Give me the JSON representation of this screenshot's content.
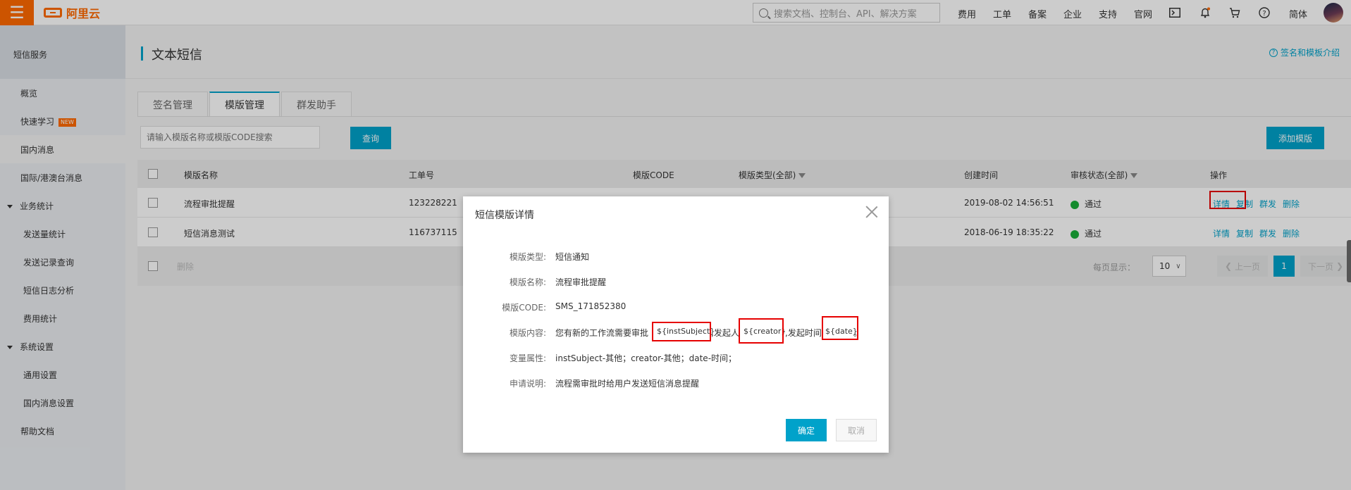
{
  "topbar": {
    "brand": "阿里云",
    "search_placeholder": "搜索文档、控制台、API、解决方案",
    "nav": [
      "费用",
      "工单",
      "备案",
      "企业",
      "支持",
      "官网"
    ],
    "lang": "简体"
  },
  "sidebar": {
    "title": "短信服务",
    "items": [
      {
        "label": "概览"
      },
      {
        "label": "快速学习",
        "tag": "NEW"
      },
      {
        "label": "国内消息"
      },
      {
        "label": "国际/港澳台消息"
      },
      {
        "label": "业务统计"
      },
      {
        "label": "发送量统计"
      },
      {
        "label": "发送记录查询"
      },
      {
        "label": "短信日志分析"
      },
      {
        "label": "费用统计"
      },
      {
        "label": "系统设置"
      },
      {
        "label": "通用设置"
      },
      {
        "label": "国内消息设置"
      },
      {
        "label": "帮助文档"
      }
    ]
  },
  "page": {
    "title": "文本短信",
    "help_link": "签名和模板介绍",
    "tabs": [
      "签名管理",
      "模版管理",
      "群发助手"
    ],
    "search_placeholder": "请输入模版名称或模版CODE搜索",
    "query_button": "查询",
    "add_button": "添加模版"
  },
  "table": {
    "headers": [
      "模版名称",
      "工单号",
      "模版CODE",
      "模版类型(全部)",
      "创建时间",
      "审核状态(全部)",
      "操作"
    ],
    "rows": [
      {
        "name": "流程审批提醒",
        "ticket": "123228221",
        "created": "2019-08-02 14:56:51",
        "status": "通过"
      },
      {
        "name": "短信消息测试",
        "ticket": "116737115",
        "created": "2018-06-19 18:35:22",
        "status": "通过"
      }
    ],
    "ops": [
      "详情",
      "复制",
      "群发",
      "删除"
    ],
    "delete_label": "删除",
    "page_size_label": "每页显示：",
    "page_size": "10",
    "prev": "上一页",
    "next": "下一页",
    "current_page": "1"
  },
  "modal": {
    "title": "短信模版详情",
    "fields": [
      {
        "label": "模版类型:",
        "value": "短信通知"
      },
      {
        "label": "模版名称:",
        "value": "流程审批提醒"
      },
      {
        "label": "模版CODE:",
        "value": "SMS_171852380"
      },
      {
        "label": "模版内容:",
        "parts": [
          "您有新的工作流需要审批",
          "${instSubject}",
          ",发起人",
          "${creator}",
          ",发起时间",
          "${date}",
          "。"
        ]
      },
      {
        "label": "变量属性:",
        "value": "instSubject-其他；creator-其他；date-时间；"
      },
      {
        "label": "申请说明:",
        "value": "流程需审批时给用户发送短信消息提醒"
      }
    ],
    "ok": "确定",
    "cancel": "取消"
  }
}
